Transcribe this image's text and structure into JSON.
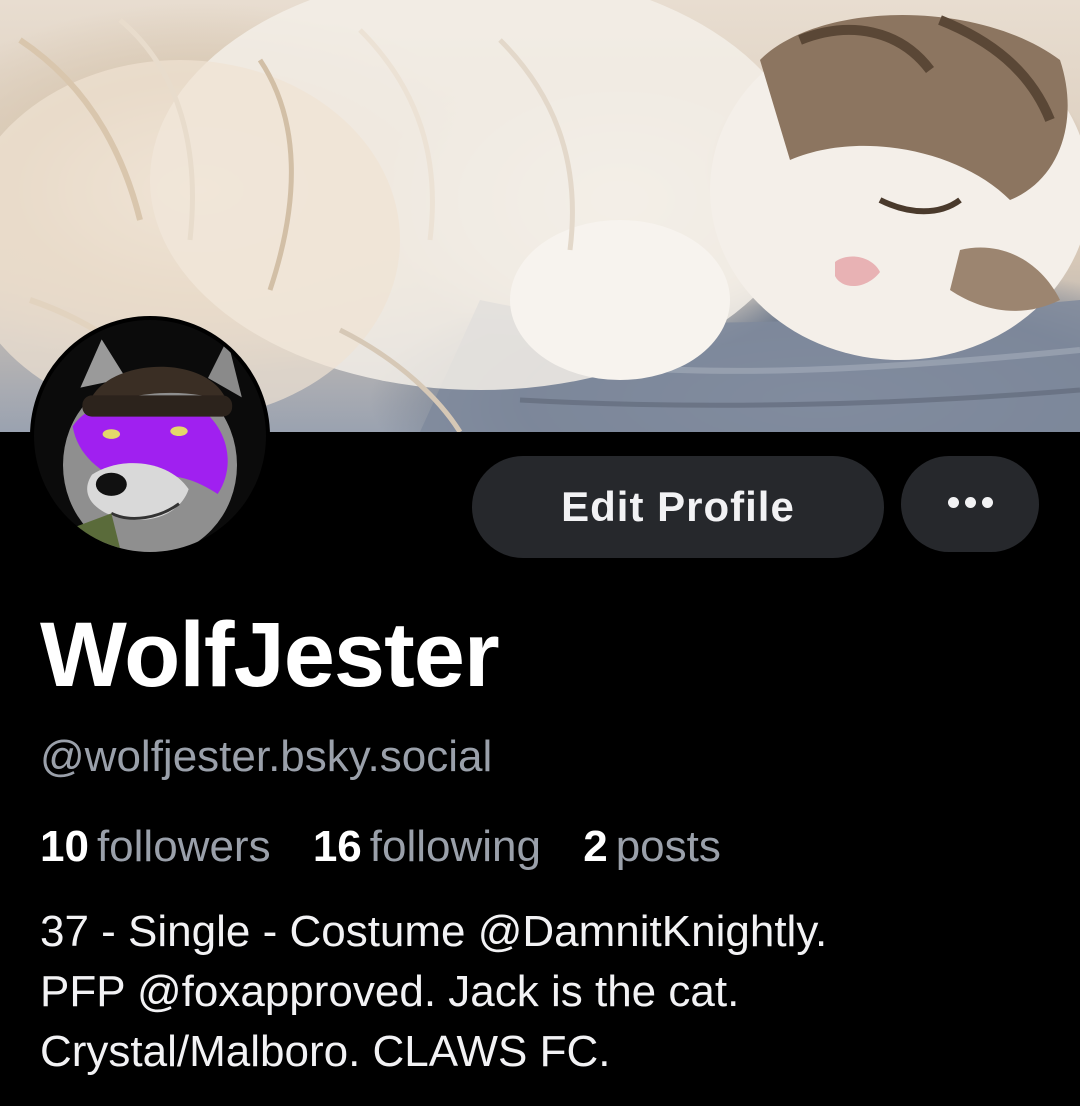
{
  "profile": {
    "display_name": "WolfJester",
    "handle": "@wolfjester.bsky.social",
    "bio_lines": [
      "37 - Single - Costume @DamnitKnightly.",
      "PFP @foxapproved. Jack is the cat.",
      "Crystal/Malboro. CLAWS FC."
    ]
  },
  "stats": {
    "followers_count": "10",
    "followers_label": "followers",
    "following_count": "16",
    "following_label": "following",
    "posts_count": "2",
    "posts_label": "posts"
  },
  "buttons": {
    "edit_profile_label": "Edit Profile",
    "more_icon": "more-horizontal-icon"
  },
  "colors": {
    "background": "#000000",
    "button_bg": "#26282c",
    "muted_text": "#9aa0aa",
    "avatar_accent": "#a020f0"
  }
}
